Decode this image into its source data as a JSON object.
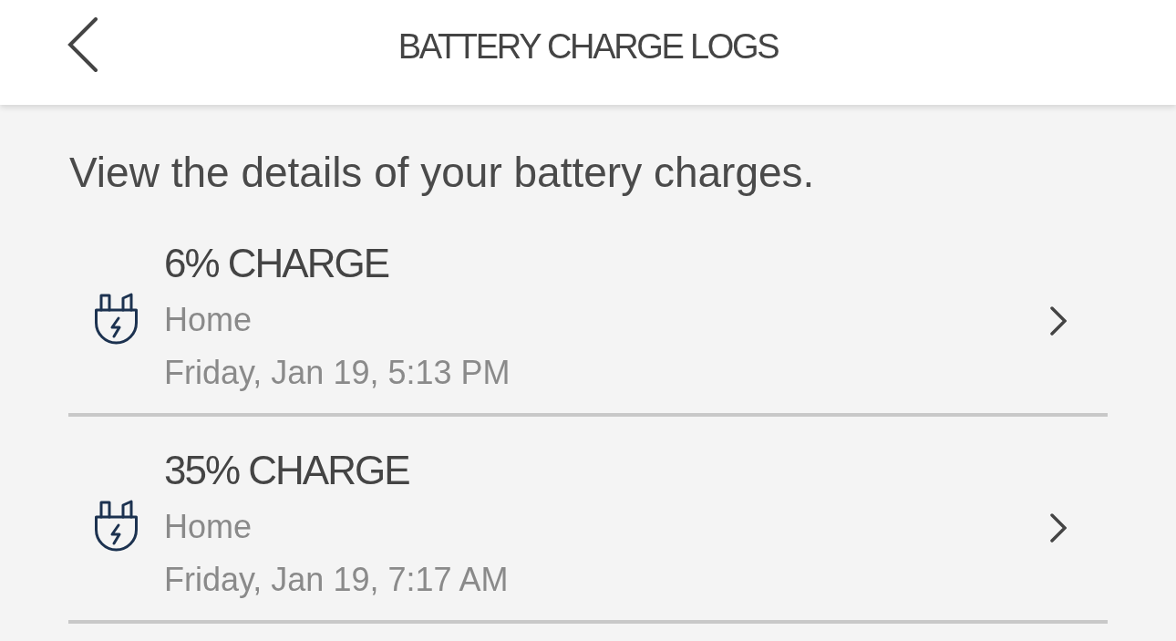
{
  "header": {
    "title": "BATTERY CHARGE LOGS"
  },
  "intro": "View the details of your battery charges.",
  "charges": [
    {
      "title": "6% CHARGE",
      "location": "Home",
      "time": "Friday, Jan 19, 5:13 PM"
    },
    {
      "title": "35% CHARGE",
      "location": "Home",
      "time": "Friday, Jan 19, 7:17 AM"
    }
  ]
}
